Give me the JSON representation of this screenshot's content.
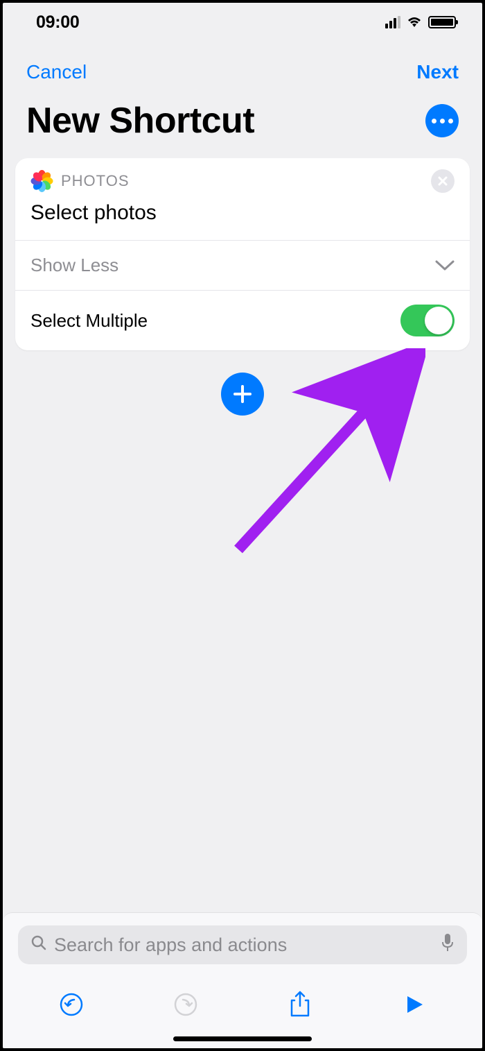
{
  "status": {
    "time": "09:00"
  },
  "nav": {
    "cancel": "Cancel",
    "next": "Next"
  },
  "title": "New Shortcut",
  "card": {
    "appLabel": "PHOTOS",
    "actionTitle": "Select photos",
    "showLess": "Show Less",
    "selectMultiple": "Select Multiple",
    "toggleOn": true
  },
  "search": {
    "placeholder": "Search for apps and actions"
  },
  "colors": {
    "accent": "#007aff",
    "toggleOn": "#34c759",
    "arrow": "#a020f0"
  }
}
